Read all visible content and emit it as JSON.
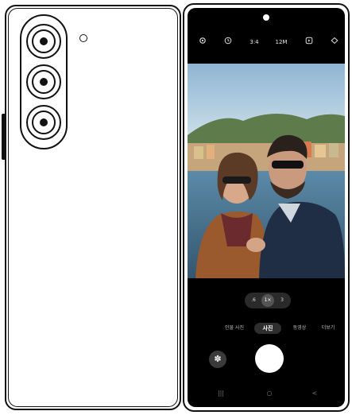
{
  "camera_app": {
    "top_bar": {
      "settings_icon": "gear-icon",
      "timer_icon": "timer-icon",
      "aspect_ratio": "3:4",
      "resolution": "12M",
      "motion_photo_icon": "motion-photo-icon",
      "filters_icon": "layers-icon"
    },
    "zoom": {
      "options": [
        ".6",
        "1×",
        "3"
      ],
      "selected": "1×"
    },
    "modes": {
      "items": [
        "인물 사진",
        "사진",
        "동영상",
        "더보기"
      ],
      "selected": "사진"
    },
    "bottom_controls": {
      "gallery_icon": "flower-icon",
      "shutter": "shutter-button"
    },
    "navbar": {
      "recents": "|||",
      "home": "○",
      "back": "<"
    }
  },
  "colors": {
    "screen_bg": "#000000",
    "pill_bg": "#2a2a2a",
    "active_zoom": "#555555",
    "shutter": "#ffffff"
  }
}
